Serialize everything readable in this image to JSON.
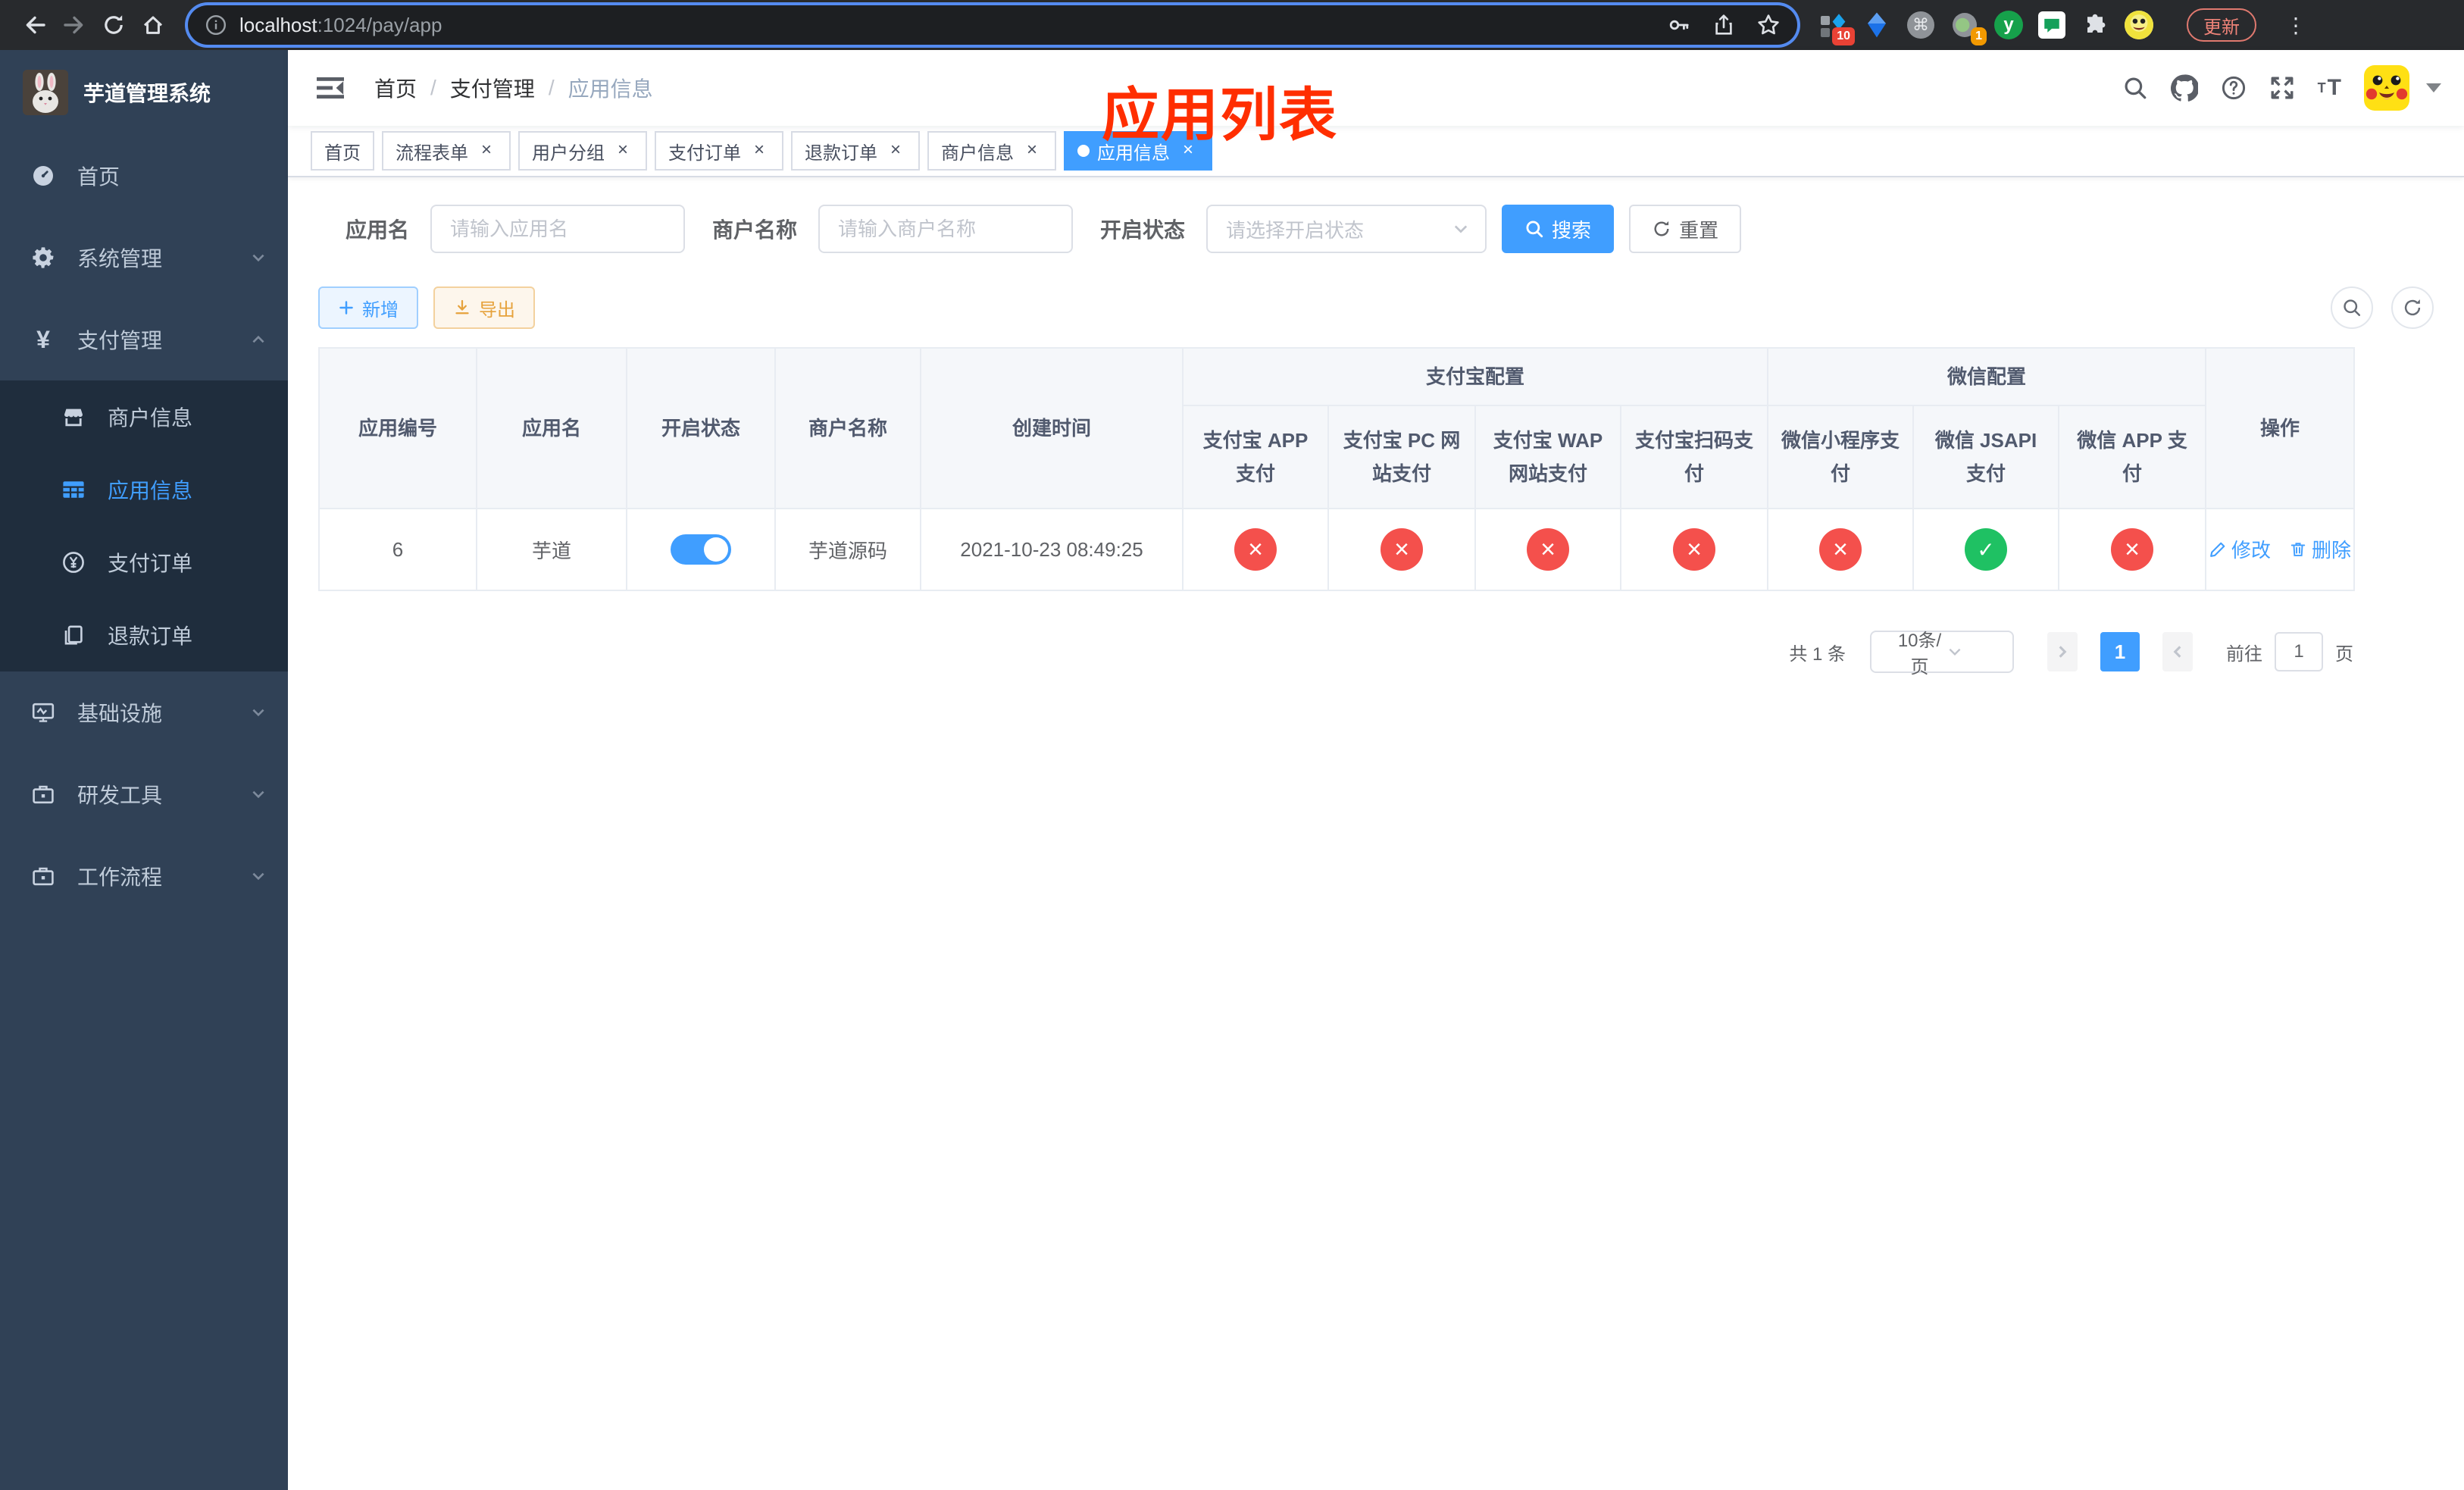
{
  "browser": {
    "url": {
      "host": "localhost",
      "path": ":1024/pay/app"
    },
    "extensions": {
      "badge_grid": "10",
      "badge_record": "1"
    },
    "update_button": "更新"
  },
  "sidebar": {
    "logo_title": "芋道管理系统",
    "items": [
      {
        "label": "首页",
        "icon": "dashboard-icon",
        "expanded": false
      },
      {
        "label": "系统管理",
        "icon": "gear-icon",
        "expanded": false
      },
      {
        "label": "支付管理",
        "icon": "yen-icon",
        "expanded": true
      },
      {
        "label": "基础设施",
        "icon": "monitor-icon",
        "expanded": false
      },
      {
        "label": "研发工具",
        "icon": "briefcase-icon",
        "expanded": false
      },
      {
        "label": "工作流程",
        "icon": "briefcase-icon",
        "expanded": false
      }
    ],
    "submenu": [
      {
        "label": "商户信息",
        "icon": "shop-icon",
        "active": false
      },
      {
        "label": "应用信息",
        "icon": "grid-icon",
        "active": true
      },
      {
        "label": "支付订单",
        "icon": "yen-circle-icon",
        "active": false
      },
      {
        "label": "退款订单",
        "icon": "document-icon",
        "active": false
      }
    ]
  },
  "navbar": {
    "breadcrumb": [
      "首页",
      "支付管理",
      "应用信息"
    ],
    "annotation": "应用列表"
  },
  "tags": [
    {
      "label": "首页",
      "closable": false,
      "active": false
    },
    {
      "label": "流程表单",
      "closable": true,
      "active": false
    },
    {
      "label": "用户分组",
      "closable": true,
      "active": false
    },
    {
      "label": "支付订单",
      "closable": true,
      "active": false
    },
    {
      "label": "退款订单",
      "closable": true,
      "active": false
    },
    {
      "label": "商户信息",
      "closable": true,
      "active": false
    },
    {
      "label": "应用信息",
      "closable": true,
      "active": true
    }
  ],
  "filters": {
    "app_name": {
      "label": "应用名",
      "placeholder": "请输入应用名",
      "value": ""
    },
    "merchant_name": {
      "label": "商户名称",
      "placeholder": "请输入商户名称",
      "value": ""
    },
    "status": {
      "label": "开启状态",
      "placeholder": "请选择开启状态",
      "value": ""
    },
    "search_button": "搜索",
    "reset_button": "重置"
  },
  "toolbar": {
    "add_button": "新增",
    "export_button": "导出"
  },
  "table": {
    "plain_columns": [
      "应用编号",
      "应用名",
      "开启状态",
      "商户名称",
      "创建时间"
    ],
    "groups": [
      {
        "label": "支付宝配置",
        "columns": [
          "支付宝 APP 支付",
          "支付宝 PC 网站支付",
          "支付宝 WAP 网站支付",
          "支付宝扫码支付"
        ]
      },
      {
        "label": "微信配置",
        "columns": [
          "微信小程序支付",
          "微信 JSAPI 支付",
          "微信 APP 支付"
        ]
      }
    ],
    "action_column": "操作",
    "rows": [
      {
        "app_id": "6",
        "app_name": "芋道",
        "enabled": true,
        "merchant_name": "芋道源码",
        "create_time": "2021-10-23 08:49:25",
        "pay_status": [
          "no",
          "no",
          "no",
          "no",
          "no",
          "yes",
          "no"
        ],
        "edit_label": "修改",
        "delete_label": "删除"
      }
    ]
  },
  "pagination": {
    "total_text": "共 1 条",
    "page_size_text": "10条/页",
    "current_page": "1",
    "goto_text": "前往",
    "goto_value": "1",
    "goto_unit": "页"
  },
  "colors": {
    "primary": "#409eff",
    "success_circle": "#1fc163",
    "danger_circle": "#f4504c",
    "warning_text": "#e6a23c",
    "annotation_red": "#ff2e00",
    "sidebar_bg": "#304156",
    "sidebar_submenu_bg": "#1f2d3d",
    "sidebar_text": "#bfcbd9",
    "chrome_bg": "#282a2d"
  },
  "icons": {
    "chrome": [
      "back-icon",
      "forward-icon",
      "reload-icon",
      "home-icon",
      "info-icon",
      "key-icon",
      "share-icon",
      "star-icon",
      "grid-ext-icon",
      "kite-ext-icon",
      "command-ext-icon",
      "record-ext-icon",
      "y-ext-icon",
      "chat-ext-icon",
      "puzzle-icon",
      "pikachu-avatar",
      "more-vert-icon"
    ],
    "navbar": [
      "hamburger-fold-icon",
      "search-icon",
      "github-icon",
      "question-icon",
      "fullscreen-icon",
      "font-size-icon",
      "pikachu-avatar",
      "caret-down-icon"
    ]
  }
}
